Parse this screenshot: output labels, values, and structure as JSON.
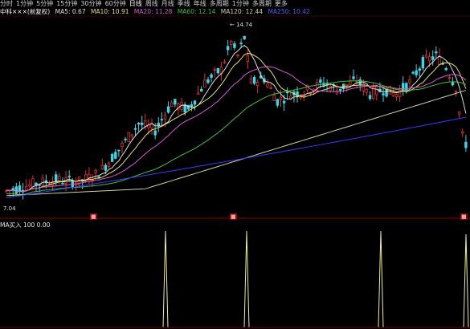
{
  "toolbar": {
    "tabs": [
      "分时",
      "1分钟",
      "5分钟",
      "15分钟",
      "30分钟",
      "60分钟",
      "日线",
      "周线",
      "月线",
      "季线",
      "年线",
      "多周期",
      "1分钟",
      "多周期",
      "更多"
    ],
    "active_index": 6
  },
  "main_chart": {
    "stock_label": "中科×××(前复权)",
    "ma_caption": "MA5: 0.67",
    "ma_values": [
      {
        "label": "MA10: 10.91",
        "color": "#e0e0e0"
      },
      {
        "label": "MA20: 11.28",
        "color": "#d65ad6"
      },
      {
        "label": "MA60: 12.14",
        "color": "#3fbf3f"
      },
      {
        "label": "MA120: 12.44",
        "color": "#d0d0a0"
      },
      {
        "label": "MA250: 10.42",
        "color": "#3a3aff"
      }
    ],
    "high_label": "14.74",
    "low_label": "7.04",
    "colors": {
      "up": "#e03030",
      "down": "#3ad7e8",
      "ma5": "#e0e0e0",
      "ma10": "#e8e060",
      "ma20": "#d65ad6",
      "ma60": "#3fbf3f",
      "ma120": "#d0d0a0",
      "ma250": "#3a3aff"
    }
  },
  "event_markers": [
    "■",
    "■",
    "■"
  ],
  "sub_chart": {
    "caption": "MA买入 100 0.00",
    "signal_color": "#f0f08c"
  }
}
